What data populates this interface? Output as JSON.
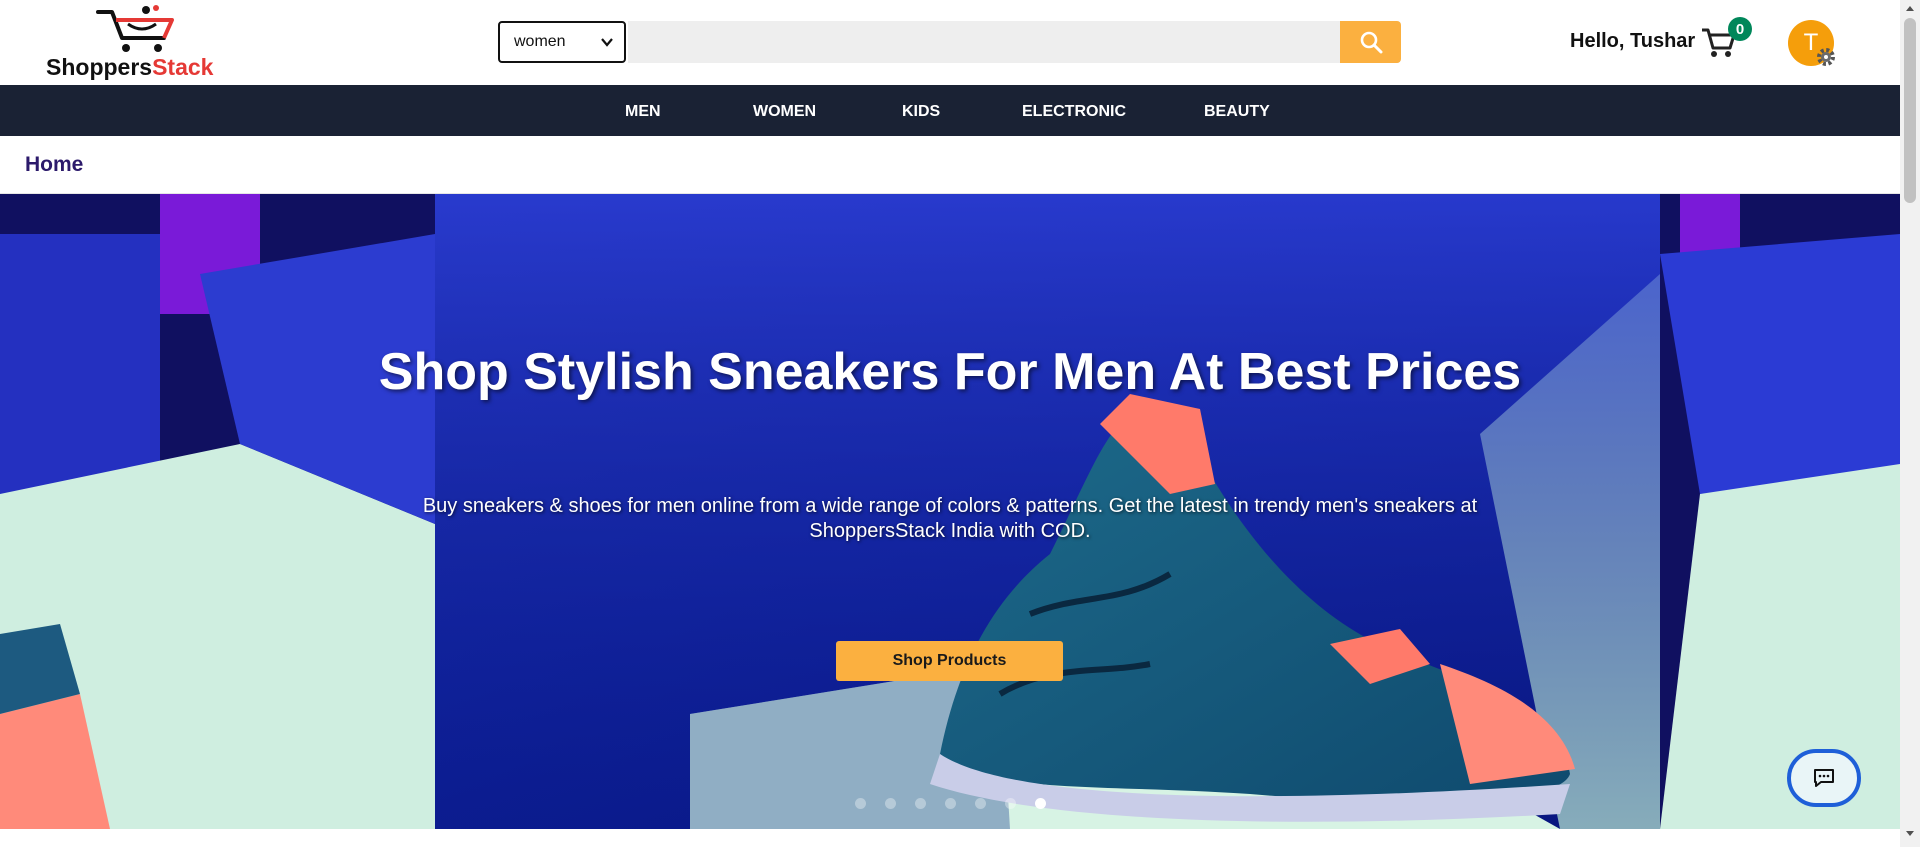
{
  "brand": {
    "name_part1": "Shoppers",
    "name_part2": "Stack",
    "logo_icon": "cart-logo-icon",
    "accent_color": "#e53935"
  },
  "search": {
    "category_selected": "women",
    "placeholder": "",
    "button_icon": "search-icon",
    "button_color": "#fbb040"
  },
  "user": {
    "greeting": "Hello, Tushar",
    "avatar_initial": "T",
    "avatar_color": "#f59e0b",
    "cart_count": "0",
    "cart_icon": "cart-icon",
    "settings_icon": "gear-icon"
  },
  "nav": {
    "items": [
      "MEN",
      "WOMEN",
      "KIDS",
      "ELECTRONIC",
      "BEAUTY"
    ],
    "background": "#1a2234"
  },
  "breadcrumb": {
    "home": "Home"
  },
  "hero": {
    "title": "Shop Stylish Sneakers For Men At Best Prices",
    "description": "Buy sneakers & shoes for men online from a wide range of colors & patterns. Get the latest in trendy men's sneakers at ShoppersStack India with COD.",
    "button_label": "Shop Products",
    "slide_count": 7,
    "active_slide": 7
  },
  "chat": {
    "icon": "chat-icon"
  }
}
